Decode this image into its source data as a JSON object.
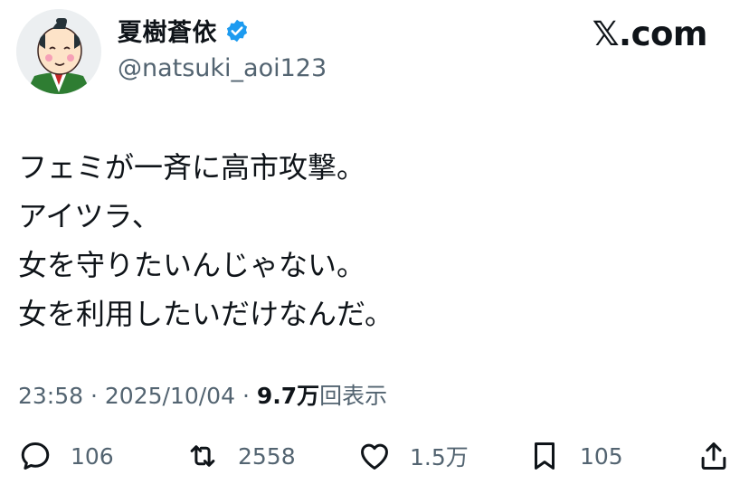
{
  "author": {
    "display_name": "夏樹蒼依",
    "handle": "@natsuki_aoi123",
    "verified": true,
    "avatar_icon": "samurai-avatar-icon"
  },
  "brand": {
    "logo_text": "𝕏.com"
  },
  "tweet": {
    "lines": [
      "フェミが一斉に高市攻撃。",
      "アイツラ、",
      "女を守りたいんじゃない。",
      "女を利用したいだけなんだ。"
    ]
  },
  "meta": {
    "time": "23:58",
    "separator": "·",
    "date": "2025/10/04",
    "views_count": "9.7万",
    "views_label": "回表示"
  },
  "actions": {
    "replies": "106",
    "reposts": "2558",
    "likes": "1.5万",
    "bookmarks": "105"
  },
  "colors": {
    "text": "#0f1419",
    "secondary": "#536471",
    "verified": "#1d9bf0"
  }
}
